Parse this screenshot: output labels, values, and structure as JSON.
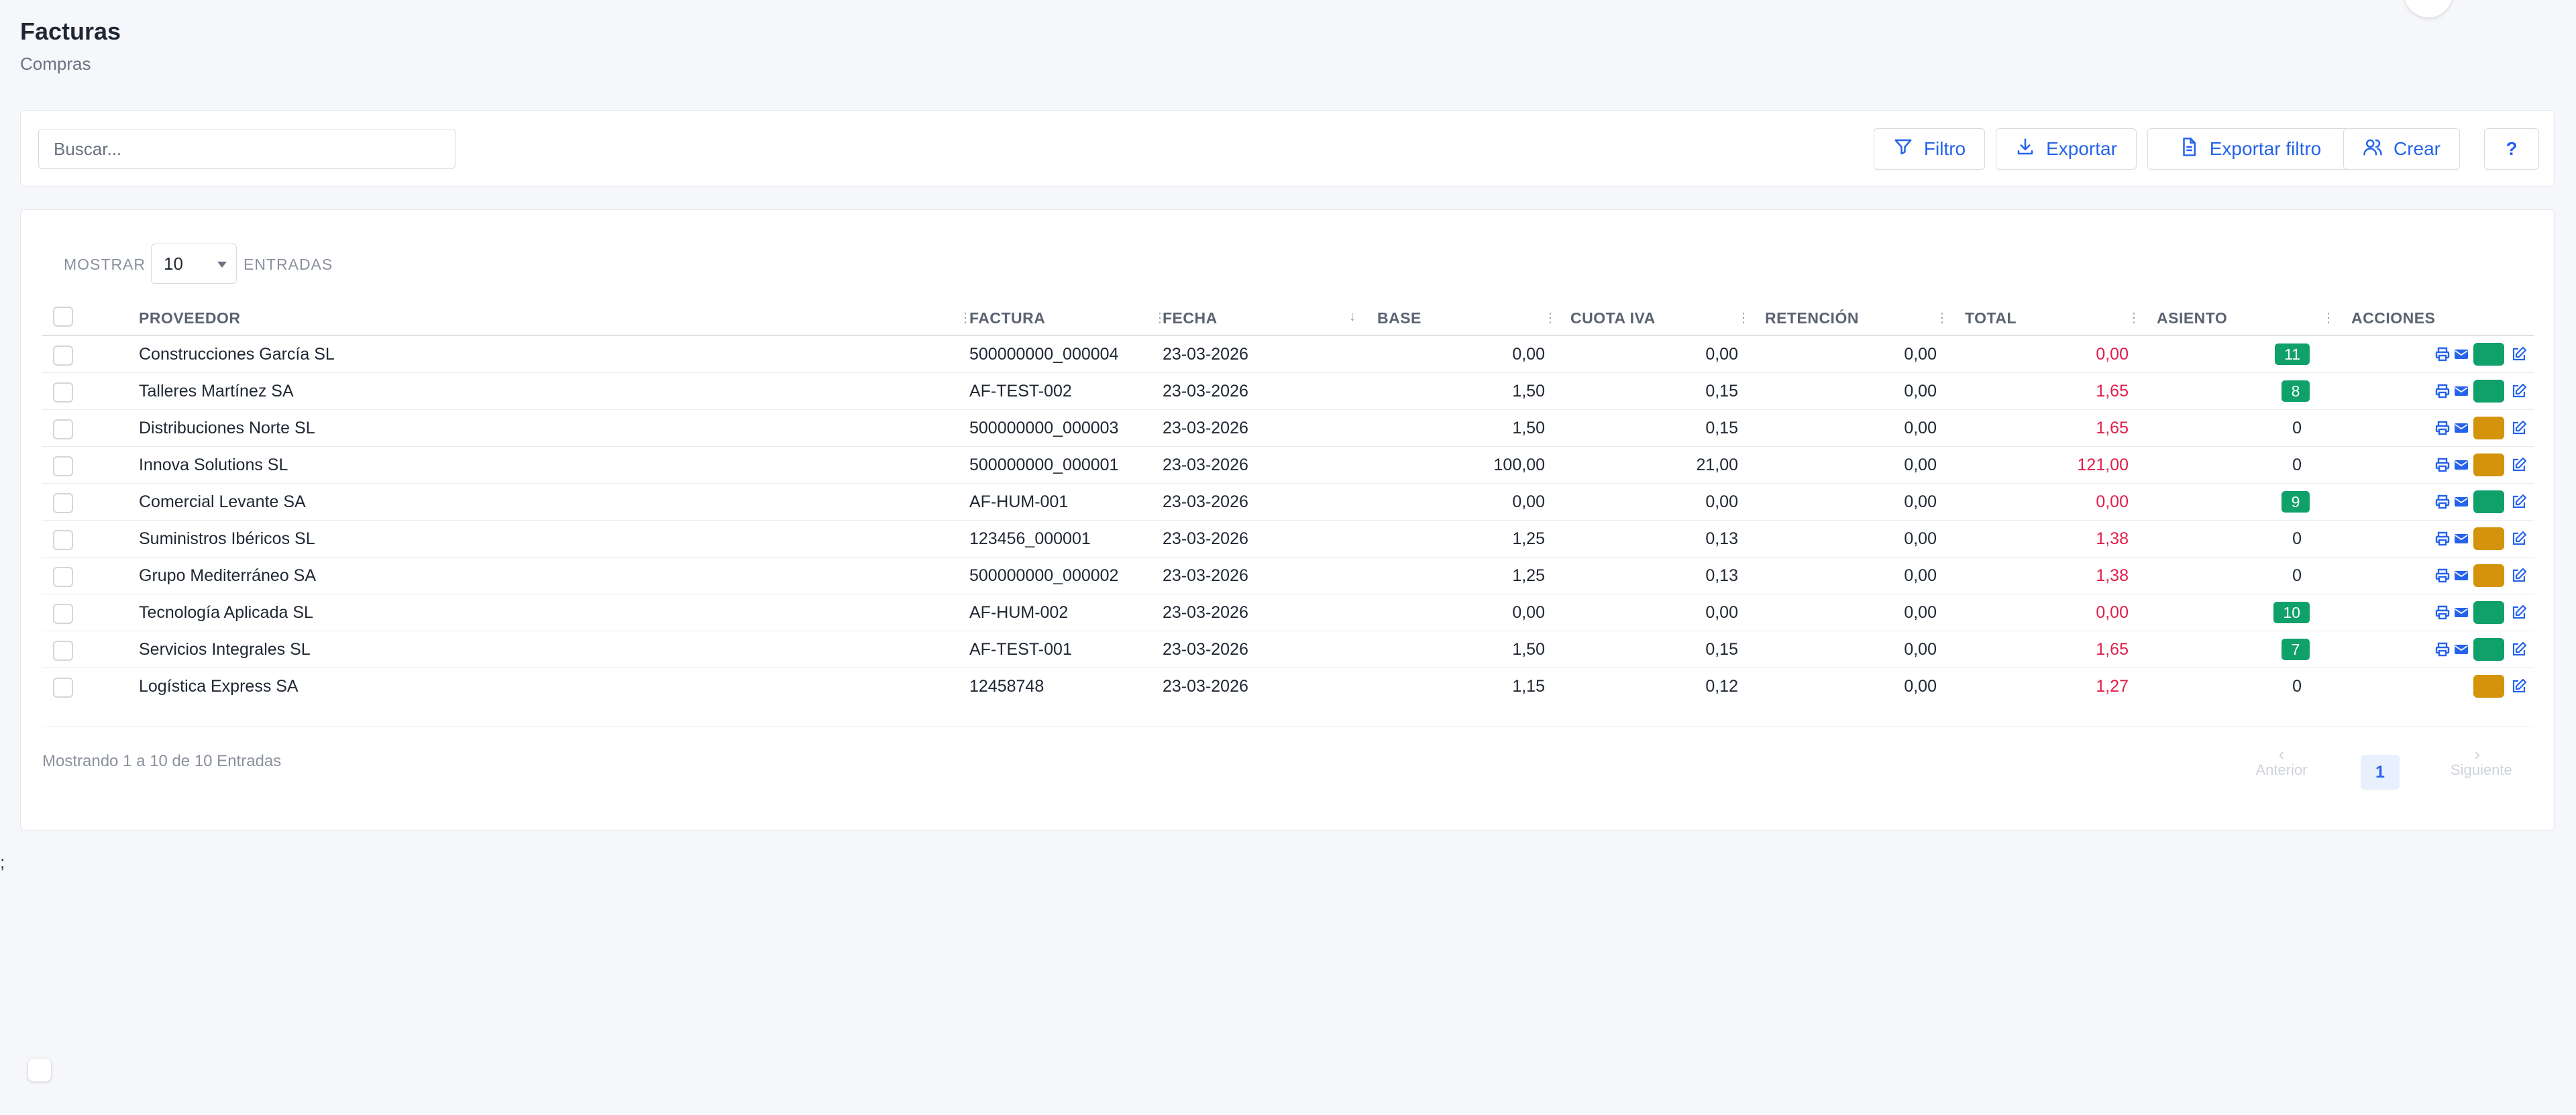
{
  "header": {
    "title": "Facturas",
    "subtitle": "Compras"
  },
  "toolbar": {
    "search_placeholder": "Buscar...",
    "search_value": "",
    "filter_label": "Filtro",
    "export_label": "Exportar",
    "export_filter_label": "Exportar filtro",
    "create_label": "Crear",
    "help_label": "?"
  },
  "table_controls": {
    "show_label": "MOSTRAR",
    "page_size": "10",
    "entries_label": "ENTRADAS"
  },
  "columns": [
    "PROVEEDOR",
    "FACTURA",
    "FECHA",
    "BASE",
    "CUOTA IVA",
    "RETENCIÓN",
    "TOTAL",
    "ASIENTO",
    "ACCIONES"
  ],
  "rows": [
    {
      "proveedor": "Construcciones García SL",
      "factura": "500000000_000004",
      "fecha": "23-03-2026",
      "base": "0,00",
      "cuota": "0,00",
      "retencion": "0,00",
      "total": "0,00",
      "asiento": "11",
      "status": "green",
      "print": true
    },
    {
      "proveedor": "Talleres Martínez SA",
      "factura": "AF-TEST-002",
      "fecha": "23-03-2026",
      "base": "1,50",
      "cuota": "0,15",
      "retencion": "0,00",
      "total": "1,65",
      "asiento": "8",
      "status": "green",
      "print": true
    },
    {
      "proveedor": "Distribuciones Norte SL",
      "factura": "500000000_000003",
      "fecha": "23-03-2026",
      "base": "1,50",
      "cuota": "0,15",
      "retencion": "0,00",
      "total": "1,65",
      "asiento": "0",
      "status": "amber",
      "print": true
    },
    {
      "proveedor": "Innova Solutions SL",
      "factura": "500000000_000001",
      "fecha": "23-03-2026",
      "base": "100,00",
      "cuota": "21,00",
      "retencion": "0,00",
      "total": "121,00",
      "asiento": "0",
      "status": "amber",
      "print": true
    },
    {
      "proveedor": "Comercial Levante SA",
      "factura": "AF-HUM-001",
      "fecha": "23-03-2026",
      "base": "0,00",
      "cuota": "0,00",
      "retencion": "0,00",
      "total": "0,00",
      "asiento": "9",
      "status": "green",
      "print": true
    },
    {
      "proveedor": "Suministros Ibéricos SL",
      "factura": "123456_000001",
      "fecha": "23-03-2026",
      "base": "1,25",
      "cuota": "0,13",
      "retencion": "0,00",
      "total": "1,38",
      "asiento": "0",
      "status": "amber",
      "print": true
    },
    {
      "proveedor": "Grupo Mediterráneo SA",
      "factura": "500000000_000002",
      "fecha": "23-03-2026",
      "base": "1,25",
      "cuota": "0,13",
      "retencion": "0,00",
      "total": "1,38",
      "asiento": "0",
      "status": "amber",
      "print": true
    },
    {
      "proveedor": "Tecnología Aplicada SL",
      "factura": "AF-HUM-002",
      "fecha": "23-03-2026",
      "base": "0,00",
      "cuota": "0,00",
      "retencion": "0,00",
      "total": "0,00",
      "asiento": "10",
      "status": "green",
      "print": true
    },
    {
      "proveedor": "Servicios Integrales SL",
      "factura": "AF-TEST-001",
      "fecha": "23-03-2026",
      "base": "1,50",
      "cuota": "0,15",
      "retencion": "0,00",
      "total": "1,65",
      "asiento": "7",
      "status": "green",
      "print": true
    },
    {
      "proveedor": "Logística Express SA",
      "factura": "12458748",
      "fecha": "23-03-2026",
      "base": "1,15",
      "cuota": "0,12",
      "retencion": "0,00",
      "total": "1,27",
      "asiento": "0",
      "status": "amber",
      "print": false
    }
  ],
  "footer": {
    "showing_text": "Mostrando 1 a 10 de 10 Entradas",
    "prev_label": "Anterior",
    "next_label": "Siguiente",
    "current_page": "1"
  },
  "stray_char": ";",
  "colors": {
    "accent": "#2563eb",
    "total_text": "#e11d48",
    "badge_green": "#10a06a",
    "status_amber": "#d4930b"
  },
  "icons": [
    "filter-icon",
    "download-icon",
    "document-icon",
    "users-icon",
    "print-icon",
    "mail-icon",
    "edit-icon",
    "sort-icon"
  ]
}
